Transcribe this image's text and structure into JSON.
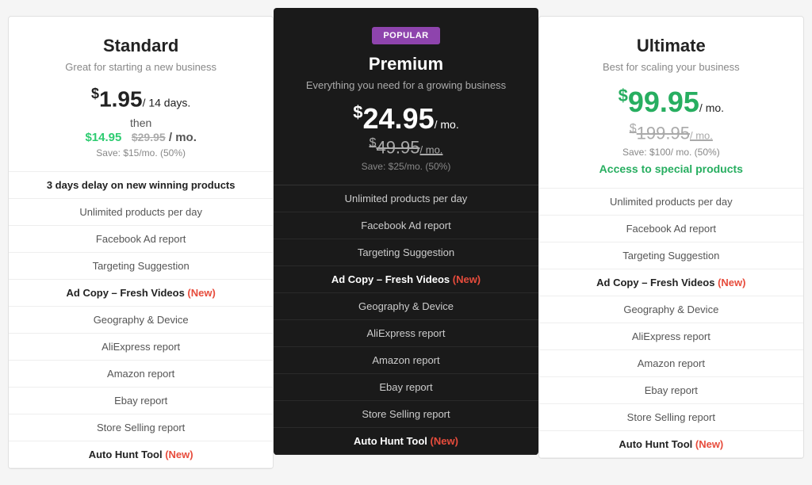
{
  "plans": [
    {
      "id": "standard",
      "name": "Standard",
      "desc": "Great for starting a new business",
      "popular": false,
      "trial_price": "1.95",
      "trial_period": "14 days.",
      "then_label": "then",
      "sale_price": "$14.95",
      "original_price": "$29.95",
      "period": "/ mo.",
      "save_text": "Save: $15/mo. (50%)",
      "features": [
        {
          "text": "3 days delay on new winning products",
          "bold": true
        },
        {
          "text": "Unlimited products per day",
          "bold": false
        },
        {
          "text": "Facebook Ad report",
          "bold": false
        },
        {
          "text": "Targeting Suggestion",
          "bold": false
        },
        {
          "text": "Ad Copy – Fresh Videos ",
          "bold": true,
          "new": "(New)"
        },
        {
          "text": "Geography & Device",
          "bold": false
        },
        {
          "text": "AliExpress report",
          "bold": false
        },
        {
          "text": "Amazon report",
          "bold": false
        },
        {
          "text": "Ebay report",
          "bold": false
        },
        {
          "text": "Store Selling report",
          "bold": false
        },
        {
          "text": "Auto Hunt Tool ",
          "bold": true,
          "new": "(New)"
        }
      ]
    },
    {
      "id": "premium",
      "name": "Premium",
      "desc": "Everything you need for a growing business",
      "popular": true,
      "popular_label": "POPULAR",
      "price": "24.95",
      "original_price": "49.95",
      "period": "/ mo.",
      "save_text": "Save: $25/mo. (50%)",
      "features": [
        {
          "text": "Unlimited products per day",
          "bold": false
        },
        {
          "text": "Facebook Ad report",
          "bold": false
        },
        {
          "text": "Targeting Suggestion",
          "bold": false
        },
        {
          "text": "Ad Copy – Fresh Videos ",
          "bold": true,
          "new": "(New)"
        },
        {
          "text": "Geography & Device",
          "bold": false
        },
        {
          "text": "AliExpress report",
          "bold": false
        },
        {
          "text": "Amazon report",
          "bold": false
        },
        {
          "text": "Ebay report",
          "bold": false
        },
        {
          "text": "Store Selling report",
          "bold": false
        },
        {
          "text": "Auto Hunt Tool ",
          "bold": true,
          "new": "(New)"
        }
      ]
    },
    {
      "id": "ultimate",
      "name": "Ultimate",
      "desc": "Best for scaling your business",
      "popular": false,
      "price": "99.95",
      "original_price": "199.95",
      "period": "/ mo.",
      "save_text": "Save: $100/ mo. (50%)",
      "special_access": "Access to special products",
      "features": [
        {
          "text": "Unlimited products per day",
          "bold": false
        },
        {
          "text": "Facebook Ad report",
          "bold": false
        },
        {
          "text": "Targeting Suggestion",
          "bold": false
        },
        {
          "text": "Ad Copy – Fresh Videos ",
          "bold": true,
          "new": "(New)"
        },
        {
          "text": "Geography & Device",
          "bold": false
        },
        {
          "text": "AliExpress report",
          "bold": false
        },
        {
          "text": "Amazon report",
          "bold": false
        },
        {
          "text": "Ebay report",
          "bold": false
        },
        {
          "text": "Store Selling report",
          "bold": false
        },
        {
          "text": "Auto Hunt Tool ",
          "bold": true,
          "new": "(New)"
        }
      ]
    }
  ]
}
